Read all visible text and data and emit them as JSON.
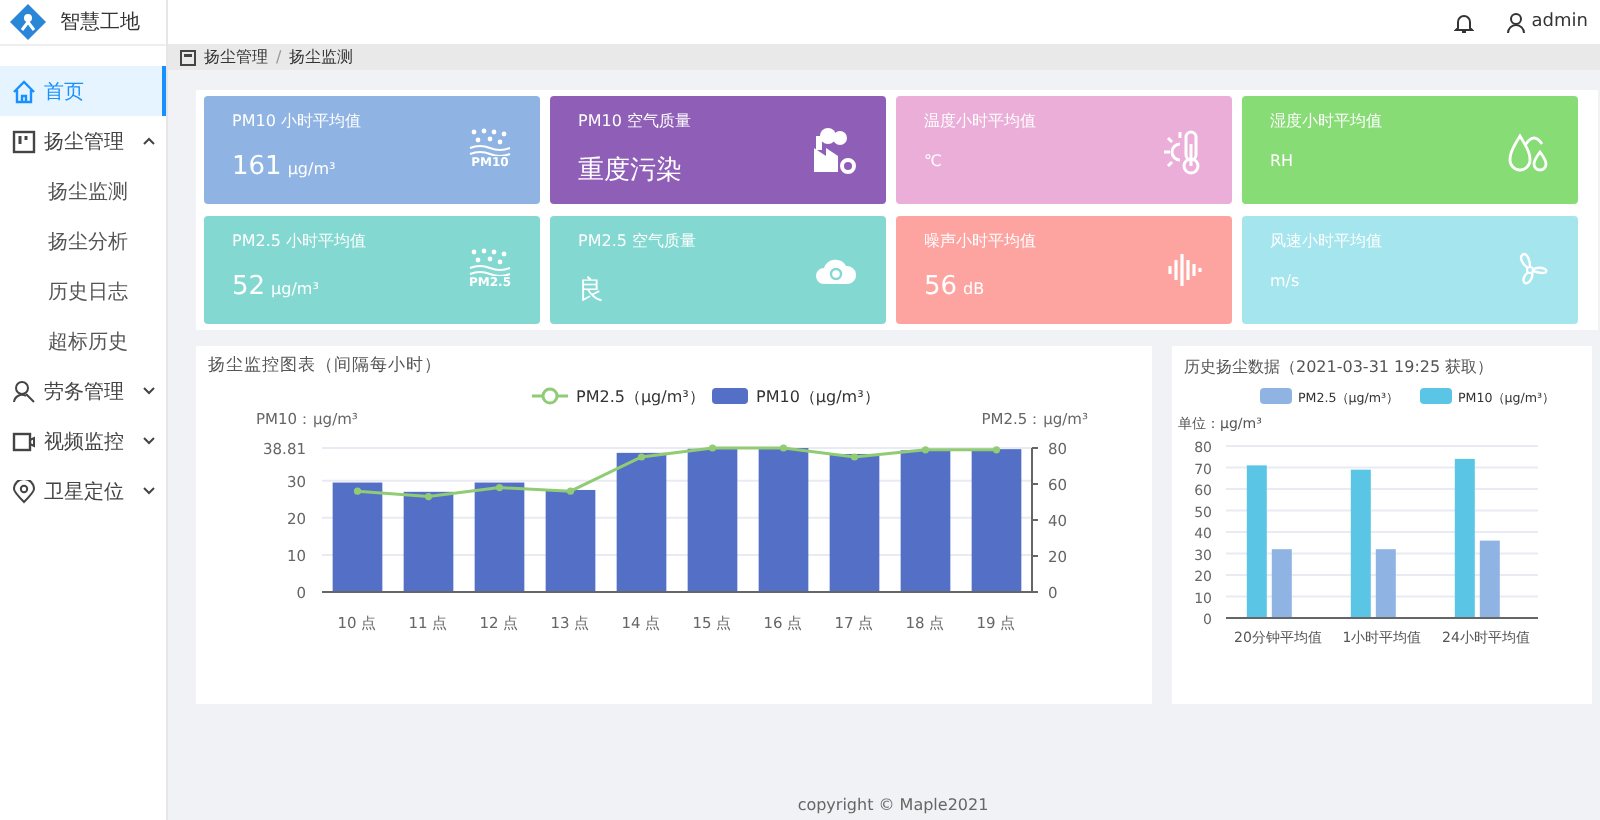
{
  "header": {
    "app_name": "智慧工地",
    "user": "admin"
  },
  "sidebar": {
    "items": [
      {
        "label": "首页",
        "selected": true
      },
      {
        "label": "扬尘管理",
        "selected": false,
        "expanded": true,
        "children": [
          {
            "label": "扬尘监测",
            "selected": false
          },
          {
            "label": "扬尘分析",
            "selected": false
          },
          {
            "label": "历史日志",
            "selected": false
          },
          {
            "label": "超标历史",
            "selected": false
          }
        ]
      },
      {
        "label": "劳务管理",
        "selected": false,
        "expanded": false
      },
      {
        "label": "视频监控",
        "selected": false,
        "expanded": false
      },
      {
        "label": "卫星定位",
        "selected": false,
        "expanded": false
      }
    ]
  },
  "breadcrumb": {
    "items": [
      "扬尘管理",
      "扬尘监测"
    ],
    "separator": "/"
  },
  "cards": [
    {
      "title": "PM10 小时平均值",
      "value": "161",
      "unit": "μg/m³",
      "icon_label": "PM10",
      "color": "#8fb3e3"
    },
    {
      "title": "PM10 空气质量",
      "value": "重度污染",
      "color": "#8f5fb8"
    },
    {
      "title": "温度小时平均值",
      "unit": "℃",
      "color": "#eaaed8"
    },
    {
      "title": "湿度小时平均值",
      "unit": "RH",
      "color": "#88dc76"
    },
    {
      "title": "PM2.5 小时平均值",
      "value": "52",
      "unit": "μg/m³",
      "icon_label": "PM2.5",
      "color": "#83d9d1"
    },
    {
      "title": "PM2.5 空气质量",
      "value": "良",
      "color": "#83d9d1"
    },
    {
      "title": "噪声小时平均值",
      "value": "56",
      "unit": "dB",
      "color": "#fda4a0"
    },
    {
      "title": "风速小时平均值",
      "unit": "m/s",
      "color": "#a5e5ee"
    }
  ],
  "hourly_panel": {
    "title": "扬尘监控图表（间隔每小时）",
    "pm10_chart": {
      "chart_data": {
        "type": "bar",
        "ylabel": "PM10：μg/m³",
        "categories": [
          "10 点",
          "11 点",
          "12 点",
          "13 点",
          "14 点",
          "15 点",
          "16 点",
          "17 点",
          "18 点",
          "19 点"
        ],
        "ylim": [
          0,
          38.81
        ],
        "yticks": [
          0,
          10,
          20,
          30,
          {
            "value": 38.81,
            "label": "38.81"
          }
        ],
        "grid": true,
        "legend": "top",
        "series": [
          {
            "name": "PM10（μg/m³）",
            "color": "#5470c6",
            "values": [
              29.5,
              27,
              29.5,
              27.5,
              37.5,
              38.6,
              38.8,
              37.2,
              38.2,
              38.5
            ]
          }
        ]
      }
    },
    "pm25_chart": {
      "chart_data": {
        "type": "line",
        "ylabel": "PM2.5：μg/m³",
        "ylim": [
          0,
          80
        ],
        "yticks": [
          0,
          20,
          40,
          60,
          80
        ],
        "legend": "top",
        "series": [
          {
            "name": "PM2.5（μg/m³）",
            "color": "#91cc75",
            "marker": "circle",
            "values": [
              56,
              53,
              58,
              56,
              75,
              80,
              80,
              75,
              79,
              79
            ]
          }
        ]
      }
    }
  },
  "history_panel": {
    "title": "历史扬尘数据（2021-03-31 19:25 获取）",
    "chart_data": {
      "type": "bar",
      "ylabel": "单位：μg/m³",
      "categories": [
        "20分钟平均值",
        "1小时平均值",
        "24小时平均值"
      ],
      "ylim": [
        0,
        80
      ],
      "yticks": [
        0,
        10,
        20,
        30,
        40,
        50,
        60,
        70,
        80
      ],
      "grid": true,
      "legend": "top",
      "series": [
        {
          "name": "PM2.5（μg/m³）",
          "color": "#8fb3e3",
          "values": [
            32,
            32,
            36
          ]
        },
        {
          "name": "PM10（μg/m³）",
          "color": "#5bc5e6",
          "values": [
            71,
            69,
            74
          ]
        }
      ]
    }
  },
  "footer": "copyright © Maple2021"
}
